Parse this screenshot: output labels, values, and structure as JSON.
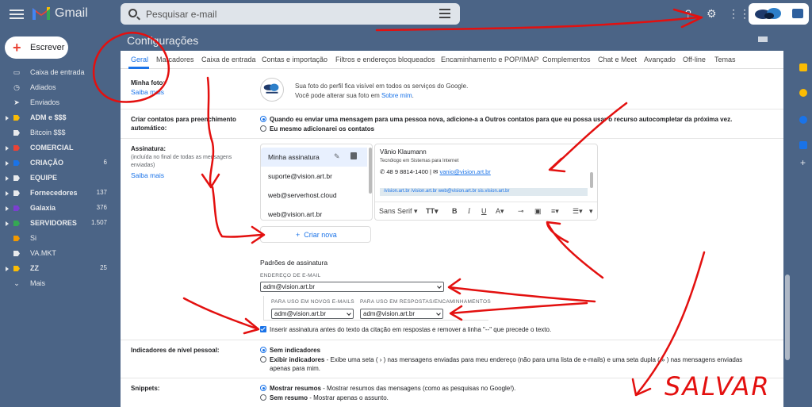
{
  "app": {
    "title": "Gmail"
  },
  "search": {
    "placeholder": "Pesquisar e-mail"
  },
  "compose": {
    "label": "Escrever"
  },
  "sidebar": {
    "items": [
      {
        "label": "Caixa de entrada",
        "count": "",
        "icon": "inbox-icon",
        "bold": false
      },
      {
        "label": "Adiados",
        "count": "",
        "icon": "clock-icon",
        "bold": false
      },
      {
        "label": "Enviados",
        "count": "",
        "icon": "send-icon",
        "bold": false
      },
      {
        "label": "ADM e $$$",
        "count": "",
        "icon": "label-icon",
        "color": "#fbbc04",
        "bold": true
      },
      {
        "label": "Bitcoin $$$",
        "count": "",
        "icon": "label-icon",
        "color": "#e8eaed",
        "bold": false
      },
      {
        "label": "COMERCIAL",
        "count": "",
        "icon": "label-icon",
        "color": "#ea4335",
        "bold": true
      },
      {
        "label": "CRIAÇÃO",
        "count": "6",
        "icon": "label-icon",
        "color": "#1a73e8",
        "bold": true
      },
      {
        "label": "EQUIPE",
        "count": "",
        "icon": "label-icon",
        "color": "#e8eaed",
        "bold": true
      },
      {
        "label": "Fornecedores",
        "count": "137",
        "icon": "label-icon",
        "color": "#e8eaed",
        "bold": true
      },
      {
        "label": "Galaxia",
        "count": "376",
        "icon": "label-icon",
        "color": "#7b3fd1",
        "bold": true
      },
      {
        "label": "SERVIDORES",
        "count": "1.507",
        "icon": "label-icon",
        "color": "#34a853",
        "bold": true
      },
      {
        "label": "Si",
        "count": "",
        "icon": "label-icon",
        "color": "#f29900",
        "bold": false
      },
      {
        "label": "VA.MKT",
        "count": "",
        "icon": "label-icon",
        "color": "#e8eaed",
        "bold": false
      },
      {
        "label": "ZZ",
        "count": "25",
        "icon": "label-icon",
        "color": "#fbbc04",
        "bold": true
      },
      {
        "label": "Mais",
        "count": "",
        "icon": "chevron-down-icon",
        "bold": false
      }
    ]
  },
  "settings": {
    "title": "Configurações",
    "tabs": [
      "Geral",
      "Marcadores",
      "Caixa de entrada",
      "Contas e importação",
      "Filtros e endereços bloqueados",
      "Encaminhamento e POP/IMAP",
      "Complementos",
      "Chat e Meet",
      "Avançado",
      "Off-line",
      "Temas"
    ],
    "photo": {
      "label": "Minha foto:",
      "learn_more": "Saiba mais",
      "line1": "Sua foto do perfil fica visível em todos os serviços do Google.",
      "line2_prefix": "Você pode alterar sua foto em ",
      "line2_link": "Sobre mim",
      "line2_suffix": "."
    },
    "contacts": {
      "label": "Criar contatos para preenchimento automático:",
      "option1": "Quando eu enviar uma mensagem para uma pessoa nova, adicione-a a Outros contatos para que eu possa usar o recurso autocompletar da próxima vez.",
      "option2": "Eu mesmo adicionarei os contatos"
    },
    "signature": {
      "label": "Assinatura:",
      "note": "(incluída no final de todas as mensagens enviadas)",
      "learn_more": "Saiba mais",
      "items": [
        "Minha assinatura",
        "suporte@vision.art.br",
        "web@serverhost.cloud",
        "web@vision.art.br"
      ],
      "new_button": "Criar nova",
      "editor": {
        "name": "Vânio Klaumann",
        "role": "Tecnólogo em Sistemas para Internet",
        "phone": "48 9 8814-1400",
        "separator": "|",
        "email": "vanio@vision.art.br",
        "social": "/vision.art.br   /vision.art.br   web@vision.art.br   sis.vision.art.br",
        "font": "Sans Serif"
      },
      "defaults_title": "Padrões de assinatura",
      "email_address_label": "ENDEREÇO DE E-MAIL",
      "email_address_value": "adm@vision.art.br",
      "new_emails_label": "PARA USO EM NOVOS E-MAILS",
      "new_emails_value": "adm@vision.art.br",
      "replies_label": "PARA USO EM RESPOSTAS/ENCAMINHAMENTOS",
      "replies_value": "adm@vision.art.br",
      "insert_before": "Inserir assinatura antes do texto da citação em respostas e remover a linha \"--\" que precede o texto."
    },
    "personal_level": {
      "label": "Indicadores de nível pessoal:",
      "option1": "Sem indicadores",
      "option2_bold": "Exibir indicadores",
      "option2_rest": " - Exibe uma seta ( › ) nas mensagens enviadas para meu endereço (não para uma lista de e-mails) e uma seta dupla ( » ) nas mensagens enviadas apenas para mim."
    },
    "snippets": {
      "label": "Snippets:",
      "option1_bold": "Mostrar resumos",
      "option1_rest": " - Mostrar resumos das mensagens (como as pesquisas no Google!).",
      "option2_bold": "Sem resumo",
      "option2_rest": " - Mostrar apenas o assunto."
    }
  },
  "annotation": {
    "save_text": "SALVAR"
  },
  "colors": {
    "background": "#4b6486",
    "accent": "#1a73e8",
    "annotation": "#e3100f"
  }
}
